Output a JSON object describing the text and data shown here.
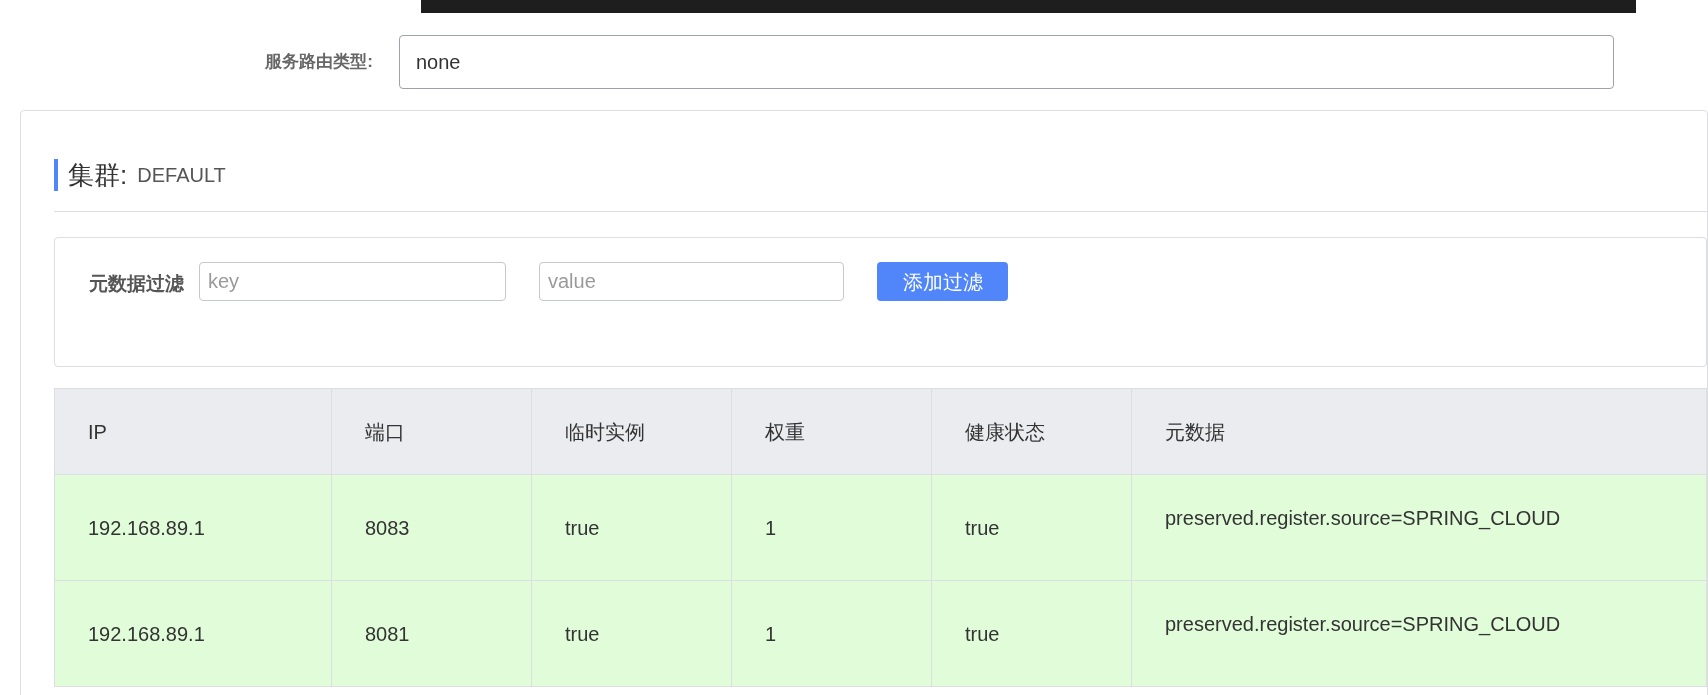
{
  "route_type": {
    "label": "服务路由类型:",
    "value": "none"
  },
  "cluster": {
    "label": "集群:",
    "name": "DEFAULT"
  },
  "filter": {
    "label": "元数据过滤",
    "key_placeholder": "key",
    "value_placeholder": "value",
    "button": "添加过滤"
  },
  "table": {
    "columns": [
      "IP",
      "端口",
      "临时实例",
      "权重",
      "健康状态",
      "元数据"
    ],
    "rows": [
      {
        "cells": [
          "192.168.89.1",
          "8083",
          "true",
          "1",
          "true",
          "preserved.register.source=SPRING_CLOUD"
        ],
        "healthy": true
      },
      {
        "cells": [
          "192.168.89.1",
          "8081",
          "true",
          "1",
          "true",
          "preserved.register.source=SPRING_CLOUD"
        ],
        "healthy": true
      }
    ]
  }
}
